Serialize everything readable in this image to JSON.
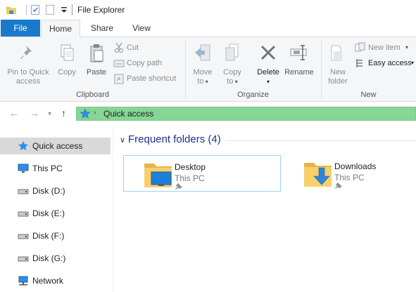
{
  "window": {
    "title": "File Explorer"
  },
  "quick_access_toolbar": {
    "icons": [
      "folder-icon",
      "properties-icon",
      "new-folder-icon",
      "customize-dropdown-icon"
    ]
  },
  "ribbon_tabs": [
    {
      "label": "File",
      "active": false
    },
    {
      "label": "Home",
      "active": true
    },
    {
      "label": "Share",
      "active": false
    },
    {
      "label": "View",
      "active": false
    }
  ],
  "ribbon": {
    "clipboard": {
      "label": "Clipboard",
      "pin_line1": "Pin to Quick",
      "pin_line2": "access",
      "copy": "Copy",
      "paste": "Paste",
      "cut": "Cut",
      "copy_path": "Copy path",
      "paste_shortcut": "Paste shortcut"
    },
    "organize": {
      "label": "Organize",
      "move_line1": "Move",
      "move_line2": "to",
      "copy_line1": "Copy",
      "copy_line2": "to",
      "delete": "Delete",
      "rename": "Rename"
    },
    "new": {
      "label": "New",
      "new_folder_line1": "New",
      "new_folder_line2": "folder",
      "new_item": "New item",
      "easy_access": "Easy access"
    }
  },
  "address_bar": {
    "location": "Quick access"
  },
  "nav_pane": [
    {
      "label": "Quick access",
      "icon": "star-icon",
      "selected": true
    },
    {
      "label": "This PC",
      "icon": "monitor-icon",
      "selected": false
    },
    {
      "label": "Disk (D:)",
      "icon": "drive-icon",
      "selected": false
    },
    {
      "label": "Disk (E:)",
      "icon": "drive-icon",
      "selected": false
    },
    {
      "label": "Disk (F:)",
      "icon": "drive-icon",
      "selected": false
    },
    {
      "label": "Disk (G:)",
      "icon": "drive-icon",
      "selected": false
    },
    {
      "label": "Network",
      "icon": "network-icon",
      "selected": false
    }
  ],
  "content": {
    "group_title": "Frequent folders (4)",
    "folders": [
      {
        "name": "Desktop",
        "location": "This PC",
        "pinned": true,
        "selected": true
      },
      {
        "name": "Downloads",
        "location": "This PC",
        "pinned": true,
        "selected": false
      }
    ]
  },
  "colors": {
    "file_tab": "#1979ca",
    "address_highlight": "#86d694",
    "group_title": "#1e3287",
    "nav_selected": "#d9d9d9"
  }
}
